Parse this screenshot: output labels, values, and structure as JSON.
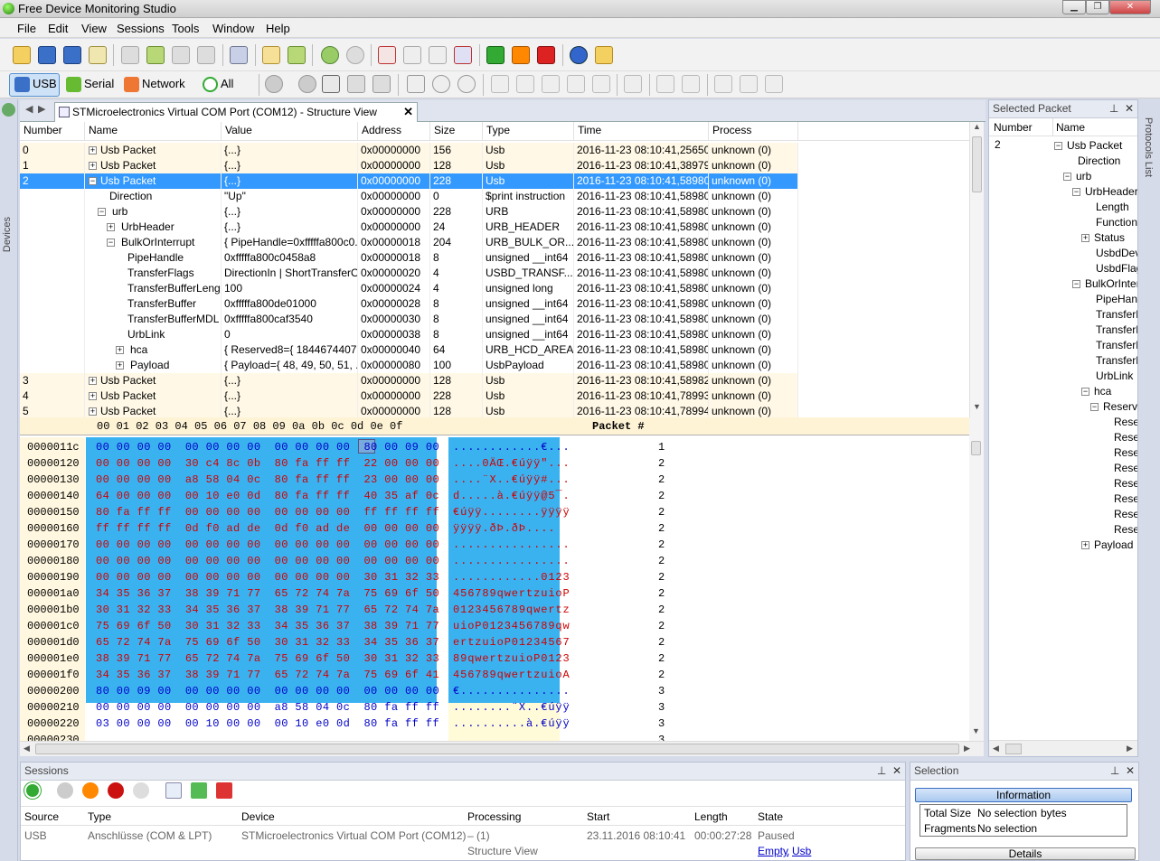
{
  "window": {
    "title": "Free Device Monitoring Studio"
  },
  "menu": [
    "File",
    "Edit",
    "View",
    "Sessions",
    "Tools",
    "Window",
    "Help"
  ],
  "toolbar2": {
    "usb": "USB",
    "serial": "Serial",
    "network": "Network",
    "all": "All"
  },
  "left_strip": {
    "label": "Devices"
  },
  "right_strip": {
    "label": "Protocols List"
  },
  "doc_tab": {
    "title": "STMicroelectronics Virtual COM Port (COM12) - Structure View"
  },
  "grid": {
    "columns": [
      "Number",
      "Name",
      "Value",
      "Address",
      "Size",
      "Type",
      "Time",
      "Process"
    ],
    "rows": [
      {
        "num": "0",
        "name": "Usb Packet",
        "value": "{...}",
        "addr": "0x00000000",
        "size": "156",
        "type": "Usb",
        "time": "2016-11-23 08:10:41,25650...",
        "proc": "unknown (0)",
        "level": 0,
        "pm": "+",
        "kind": "top"
      },
      {
        "num": "1",
        "name": "Usb Packet",
        "value": "{...}",
        "addr": "0x00000000",
        "size": "128",
        "type": "Usb",
        "time": "2016-11-23 08:10:41,38979...",
        "proc": "unknown (0)",
        "level": 0,
        "pm": "+",
        "kind": "top"
      },
      {
        "num": "2",
        "name": "Usb Packet",
        "value": "{...}",
        "addr": "0x00000000",
        "size": "228",
        "type": "Usb",
        "time": "2016-11-23 08:10:41,58980...",
        "proc": "unknown (0)",
        "level": 0,
        "pm": "-",
        "kind": "sel"
      },
      {
        "num": "",
        "name": "Direction",
        "value": "\"Up\"",
        "addr": "0x00000000",
        "size": "0",
        "type": "$print instruction",
        "time": "2016-11-23 08:10:41,58980...",
        "proc": "unknown (0)",
        "level": 1,
        "pm": "",
        "kind": "child"
      },
      {
        "num": "",
        "name": "urb",
        "value": "{...}",
        "addr": "0x00000000",
        "size": "228",
        "type": "URB",
        "time": "2016-11-23 08:10:41,58980...",
        "proc": "unknown (0)",
        "level": 1,
        "pm": "-",
        "kind": "child"
      },
      {
        "num": "",
        "name": "UrbHeader",
        "value": "{...}",
        "addr": "0x00000000",
        "size": "24",
        "type": "URB_HEADER",
        "time": "2016-11-23 08:10:41,58980...",
        "proc": "unknown (0)",
        "level": 2,
        "pm": "+",
        "kind": "child"
      },
      {
        "num": "",
        "name": "BulkOrInterrupt",
        "value": "{ PipeHandle=0xfffffa800c0...",
        "addr": "0x00000018",
        "size": "204",
        "type": "URB_BULK_OR...",
        "time": "2016-11-23 08:10:41,58980...",
        "proc": "unknown (0)",
        "level": 2,
        "pm": "-",
        "kind": "child"
      },
      {
        "num": "",
        "name": "PipeHandle",
        "value": "0xfffffa800c0458a8",
        "addr": "0x00000018",
        "size": "8",
        "type": "unsigned __int64",
        "time": "2016-11-23 08:10:41,58980...",
        "proc": "unknown (0)",
        "level": 3,
        "pm": "",
        "kind": "child"
      },
      {
        "num": "",
        "name": "TransferFlags",
        "value": "DirectionIn | ShortTransferO...",
        "addr": "0x00000020",
        "size": "4",
        "type": "USBD_TRANSF...",
        "time": "2016-11-23 08:10:41,58980...",
        "proc": "unknown (0)",
        "level": 3,
        "pm": "",
        "kind": "child"
      },
      {
        "num": "",
        "name": "TransferBufferLength",
        "value": "100",
        "addr": "0x00000024",
        "size": "4",
        "type": "unsigned long",
        "time": "2016-11-23 08:10:41,58980...",
        "proc": "unknown (0)",
        "level": 3,
        "pm": "",
        "kind": "child"
      },
      {
        "num": "",
        "name": "TransferBuffer",
        "value": "0xfffffa800de01000",
        "addr": "0x00000028",
        "size": "8",
        "type": "unsigned __int64",
        "time": "2016-11-23 08:10:41,58980...",
        "proc": "unknown (0)",
        "level": 3,
        "pm": "",
        "kind": "child"
      },
      {
        "num": "",
        "name": "TransferBufferMDL",
        "value": "0xfffffa800caf3540",
        "addr": "0x00000030",
        "size": "8",
        "type": "unsigned __int64",
        "time": "2016-11-23 08:10:41,58980...",
        "proc": "unknown (0)",
        "level": 3,
        "pm": "",
        "kind": "child"
      },
      {
        "num": "",
        "name": "UrbLink",
        "value": "0",
        "addr": "0x00000038",
        "size": "8",
        "type": "unsigned __int64",
        "time": "2016-11-23 08:10:41,58980...",
        "proc": "unknown (0)",
        "level": 3,
        "pm": "",
        "kind": "child"
      },
      {
        "num": "",
        "name": "hca",
        "value": "{ Reserved8={ 1844674407...",
        "addr": "0x00000040",
        "size": "64",
        "type": "URB_HCD_AREA",
        "time": "2016-11-23 08:10:41,58980...",
        "proc": "unknown (0)",
        "level": 3,
        "pm": "+",
        "kind": "child"
      },
      {
        "num": "",
        "name": "Payload",
        "value": "{ Payload={ 48, 49, 50, 51, ...",
        "addr": "0x00000080",
        "size": "100",
        "type": "UsbPayload",
        "time": "2016-11-23 08:10:41,58980...",
        "proc": "unknown (0)",
        "level": 3,
        "pm": "+",
        "kind": "child"
      },
      {
        "num": "3",
        "name": "Usb Packet",
        "value": "{...}",
        "addr": "0x00000000",
        "size": "128",
        "type": "Usb",
        "time": "2016-11-23 08:10:41,58982...",
        "proc": "unknown (0)",
        "level": 0,
        "pm": "+",
        "kind": "top"
      },
      {
        "num": "4",
        "name": "Usb Packet",
        "value": "{...}",
        "addr": "0x00000000",
        "size": "228",
        "type": "Usb",
        "time": "2016-11-23 08:10:41,78993...",
        "proc": "unknown (0)",
        "level": 0,
        "pm": "+",
        "kind": "top"
      },
      {
        "num": "5",
        "name": "Usb Packet",
        "value": "{...}",
        "addr": "0x00000000",
        "size": "128",
        "type": "Usb",
        "time": "2016-11-23 08:10:41,78994...",
        "proc": "unknown (0)",
        "level": 0,
        "pm": "+",
        "kind": "top"
      }
    ]
  },
  "hex": {
    "header": "00 01 02 03  04 05 06 07  08 09 0a 0b  0c 0d 0e 0f",
    "packet_header": "Packet #",
    "lines": [
      {
        "addr": "0000011c",
        "hex": "00 00 00 00  00 00 00 00  00 00 00 00  80 00 09 00",
        "ascii": "............€...",
        "pkt": "1",
        "blue": true
      },
      {
        "addr": "00000120",
        "hex": "00 00 00 00  30 c4 8c 0b  80 fa ff ff  22 00 00 00",
        "ascii": "....0ÄŒ.€úÿÿ\"...",
        "pkt": "2",
        "blue": false
      },
      {
        "addr": "00000130",
        "hex": "00 00 00 00  a8 58 04 0c  80 fa ff ff  23 00 00 00",
        "ascii": "....¨X..€úÿÿ#...",
        "pkt": "2",
        "blue": false
      },
      {
        "addr": "00000140",
        "hex": "64 00 00 00  00 10 e0 0d  80 fa ff ff  40 35 af 0c",
        "ascii": "d.....à.€úÿÿ@5¯.",
        "pkt": "2",
        "blue": false
      },
      {
        "addr": "00000150",
        "hex": "80 fa ff ff  00 00 00 00  00 00 00 00  ff ff ff ff",
        "ascii": "€úÿÿ........ÿÿÿÿ",
        "pkt": "2",
        "blue": false
      },
      {
        "addr": "00000160",
        "hex": "ff ff ff ff  0d f0 ad de  0d f0 ad de  00 00 00 00",
        "ascii": "ÿÿÿÿ.ð­Þ.ð­Þ....",
        "pkt": "2",
        "blue": false
      },
      {
        "addr": "00000170",
        "hex": "00 00 00 00  00 00 00 00  00 00 00 00  00 00 00 00",
        "ascii": "................",
        "pkt": "2",
        "blue": false
      },
      {
        "addr": "00000180",
        "hex": "00 00 00 00  00 00 00 00  00 00 00 00  00 00 00 00",
        "ascii": "................",
        "pkt": "2",
        "blue": false
      },
      {
        "addr": "00000190",
        "hex": "00 00 00 00  00 00 00 00  00 00 00 00  30 31 32 33",
        "ascii": "............0123",
        "pkt": "2",
        "blue": false
      },
      {
        "addr": "000001a0",
        "hex": "34 35 36 37  38 39 71 77  65 72 74 7a  75 69 6f 50",
        "ascii": "456789qwertzuioP",
        "pkt": "2",
        "blue": false
      },
      {
        "addr": "000001b0",
        "hex": "30 31 32 33  34 35 36 37  38 39 71 77  65 72 74 7a",
        "ascii": "0123456789qwertz",
        "pkt": "2",
        "blue": false
      },
      {
        "addr": "000001c0",
        "hex": "75 69 6f 50  30 31 32 33  34 35 36 37  38 39 71 77",
        "ascii": "uioP0123456789qw",
        "pkt": "2",
        "blue": false
      },
      {
        "addr": "000001d0",
        "hex": "65 72 74 7a  75 69 6f 50  30 31 32 33  34 35 36 37",
        "ascii": "ertzuioP01234567",
        "pkt": "2",
        "blue": false
      },
      {
        "addr": "000001e0",
        "hex": "38 39 71 77  65 72 74 7a  75 69 6f 50  30 31 32 33",
        "ascii": "89qwertzuioP0123",
        "pkt": "2",
        "blue": false
      },
      {
        "addr": "000001f0",
        "hex": "34 35 36 37  38 39 71 77  65 72 74 7a  75 69 6f 41",
        "ascii": "456789qwertzuioA",
        "pkt": "2",
        "blue": false
      },
      {
        "addr": "00000200",
        "hex": "80 00 09 00  00 00 00 00  00 00 00 00  00 00 00 00",
        "ascii": "€...............",
        "pkt": "3",
        "blue": true
      },
      {
        "addr": "00000210",
        "hex": "00 00 00 00  00 00 00 00  a8 58 04 0c  80 fa ff ff",
        "ascii": "........¨X..€úÿÿ",
        "pkt": "3",
        "blue": true
      },
      {
        "addr": "00000220",
        "hex": "03 00 00 00  00 10 00 00  00 10 e0 0d  80 fa ff ff",
        "ascii": "..........à.€úÿÿ",
        "pkt": "3",
        "blue": true
      },
      {
        "addr": "00000230",
        "hex": "",
        "ascii": "",
        "pkt": "3",
        "blue": true
      }
    ]
  },
  "selected_packet": {
    "title": "Selected Packet",
    "columns": [
      "Number",
      "Name"
    ],
    "number": "2",
    "tree": [
      {
        "label": "Usb Packet",
        "level": 0,
        "pm": "-"
      },
      {
        "label": "Direction",
        "level": 1,
        "pm": ""
      },
      {
        "label": "urb",
        "level": 1,
        "pm": "-"
      },
      {
        "label": "UrbHeader",
        "level": 2,
        "pm": "-"
      },
      {
        "label": "Length",
        "level": 3,
        "pm": ""
      },
      {
        "label": "Function",
        "level": 3,
        "pm": ""
      },
      {
        "label": "Status",
        "level": 3,
        "pm": "+"
      },
      {
        "label": "UsbdDevi",
        "level": 3,
        "pm": ""
      },
      {
        "label": "UsbdFlags",
        "level": 3,
        "pm": ""
      },
      {
        "label": "BulkOrInterr",
        "level": 2,
        "pm": "-"
      },
      {
        "label": "PipeHand",
        "level": 3,
        "pm": ""
      },
      {
        "label": "TransferFl",
        "level": 3,
        "pm": ""
      },
      {
        "label": "TransferBu",
        "level": 3,
        "pm": ""
      },
      {
        "label": "TransferBu",
        "level": 3,
        "pm": ""
      },
      {
        "label": "TransferBu",
        "level": 3,
        "pm": ""
      },
      {
        "label": "UrbLink",
        "level": 3,
        "pm": ""
      },
      {
        "label": "hca",
        "level": 3,
        "pm": "-"
      },
      {
        "label": "Reserve",
        "level": 4,
        "pm": "-"
      },
      {
        "label": "Reser",
        "level": 5,
        "pm": ""
      },
      {
        "label": "Reser",
        "level": 5,
        "pm": ""
      },
      {
        "label": "Reser",
        "level": 5,
        "pm": ""
      },
      {
        "label": "Reser",
        "level": 5,
        "pm": ""
      },
      {
        "label": "Reser",
        "level": 5,
        "pm": ""
      },
      {
        "label": "Reser",
        "level": 5,
        "pm": ""
      },
      {
        "label": "Reser",
        "level": 5,
        "pm": ""
      },
      {
        "label": "Reser",
        "level": 5,
        "pm": ""
      },
      {
        "label": "Payload",
        "level": 3,
        "pm": "+"
      }
    ]
  },
  "sessions": {
    "title": "Sessions",
    "columns": [
      "Source",
      "Type",
      "Device",
      "Processing",
      "Start",
      "Length",
      "State"
    ],
    "row": {
      "source": "USB",
      "type": "Anschlüsse (COM & LPT)",
      "device": "STMicroelectronics Virtual COM Port (COM12)",
      "processing": "– (1)",
      "start": "23.11.2016 08:10:41",
      "length": "00:00:27:28",
      "state": "Paused"
    },
    "sub": {
      "processing": "Structure View",
      "empty": "Empty",
      "usb": "Usb",
      "comma": ","
    }
  },
  "selection": {
    "title": "Selection",
    "info_tab": "Information",
    "total_size_label": "Total Size",
    "total_size": "No selection",
    "bytes": "bytes",
    "fragments_label": "Fragments",
    "fragments": "No selection",
    "details": "Details"
  },
  "colors": {
    "selected_row": "#3399ff",
    "hex_select": "#3bb2f0",
    "hex_red": "#d00000",
    "hex_blue": "#0000c8"
  }
}
